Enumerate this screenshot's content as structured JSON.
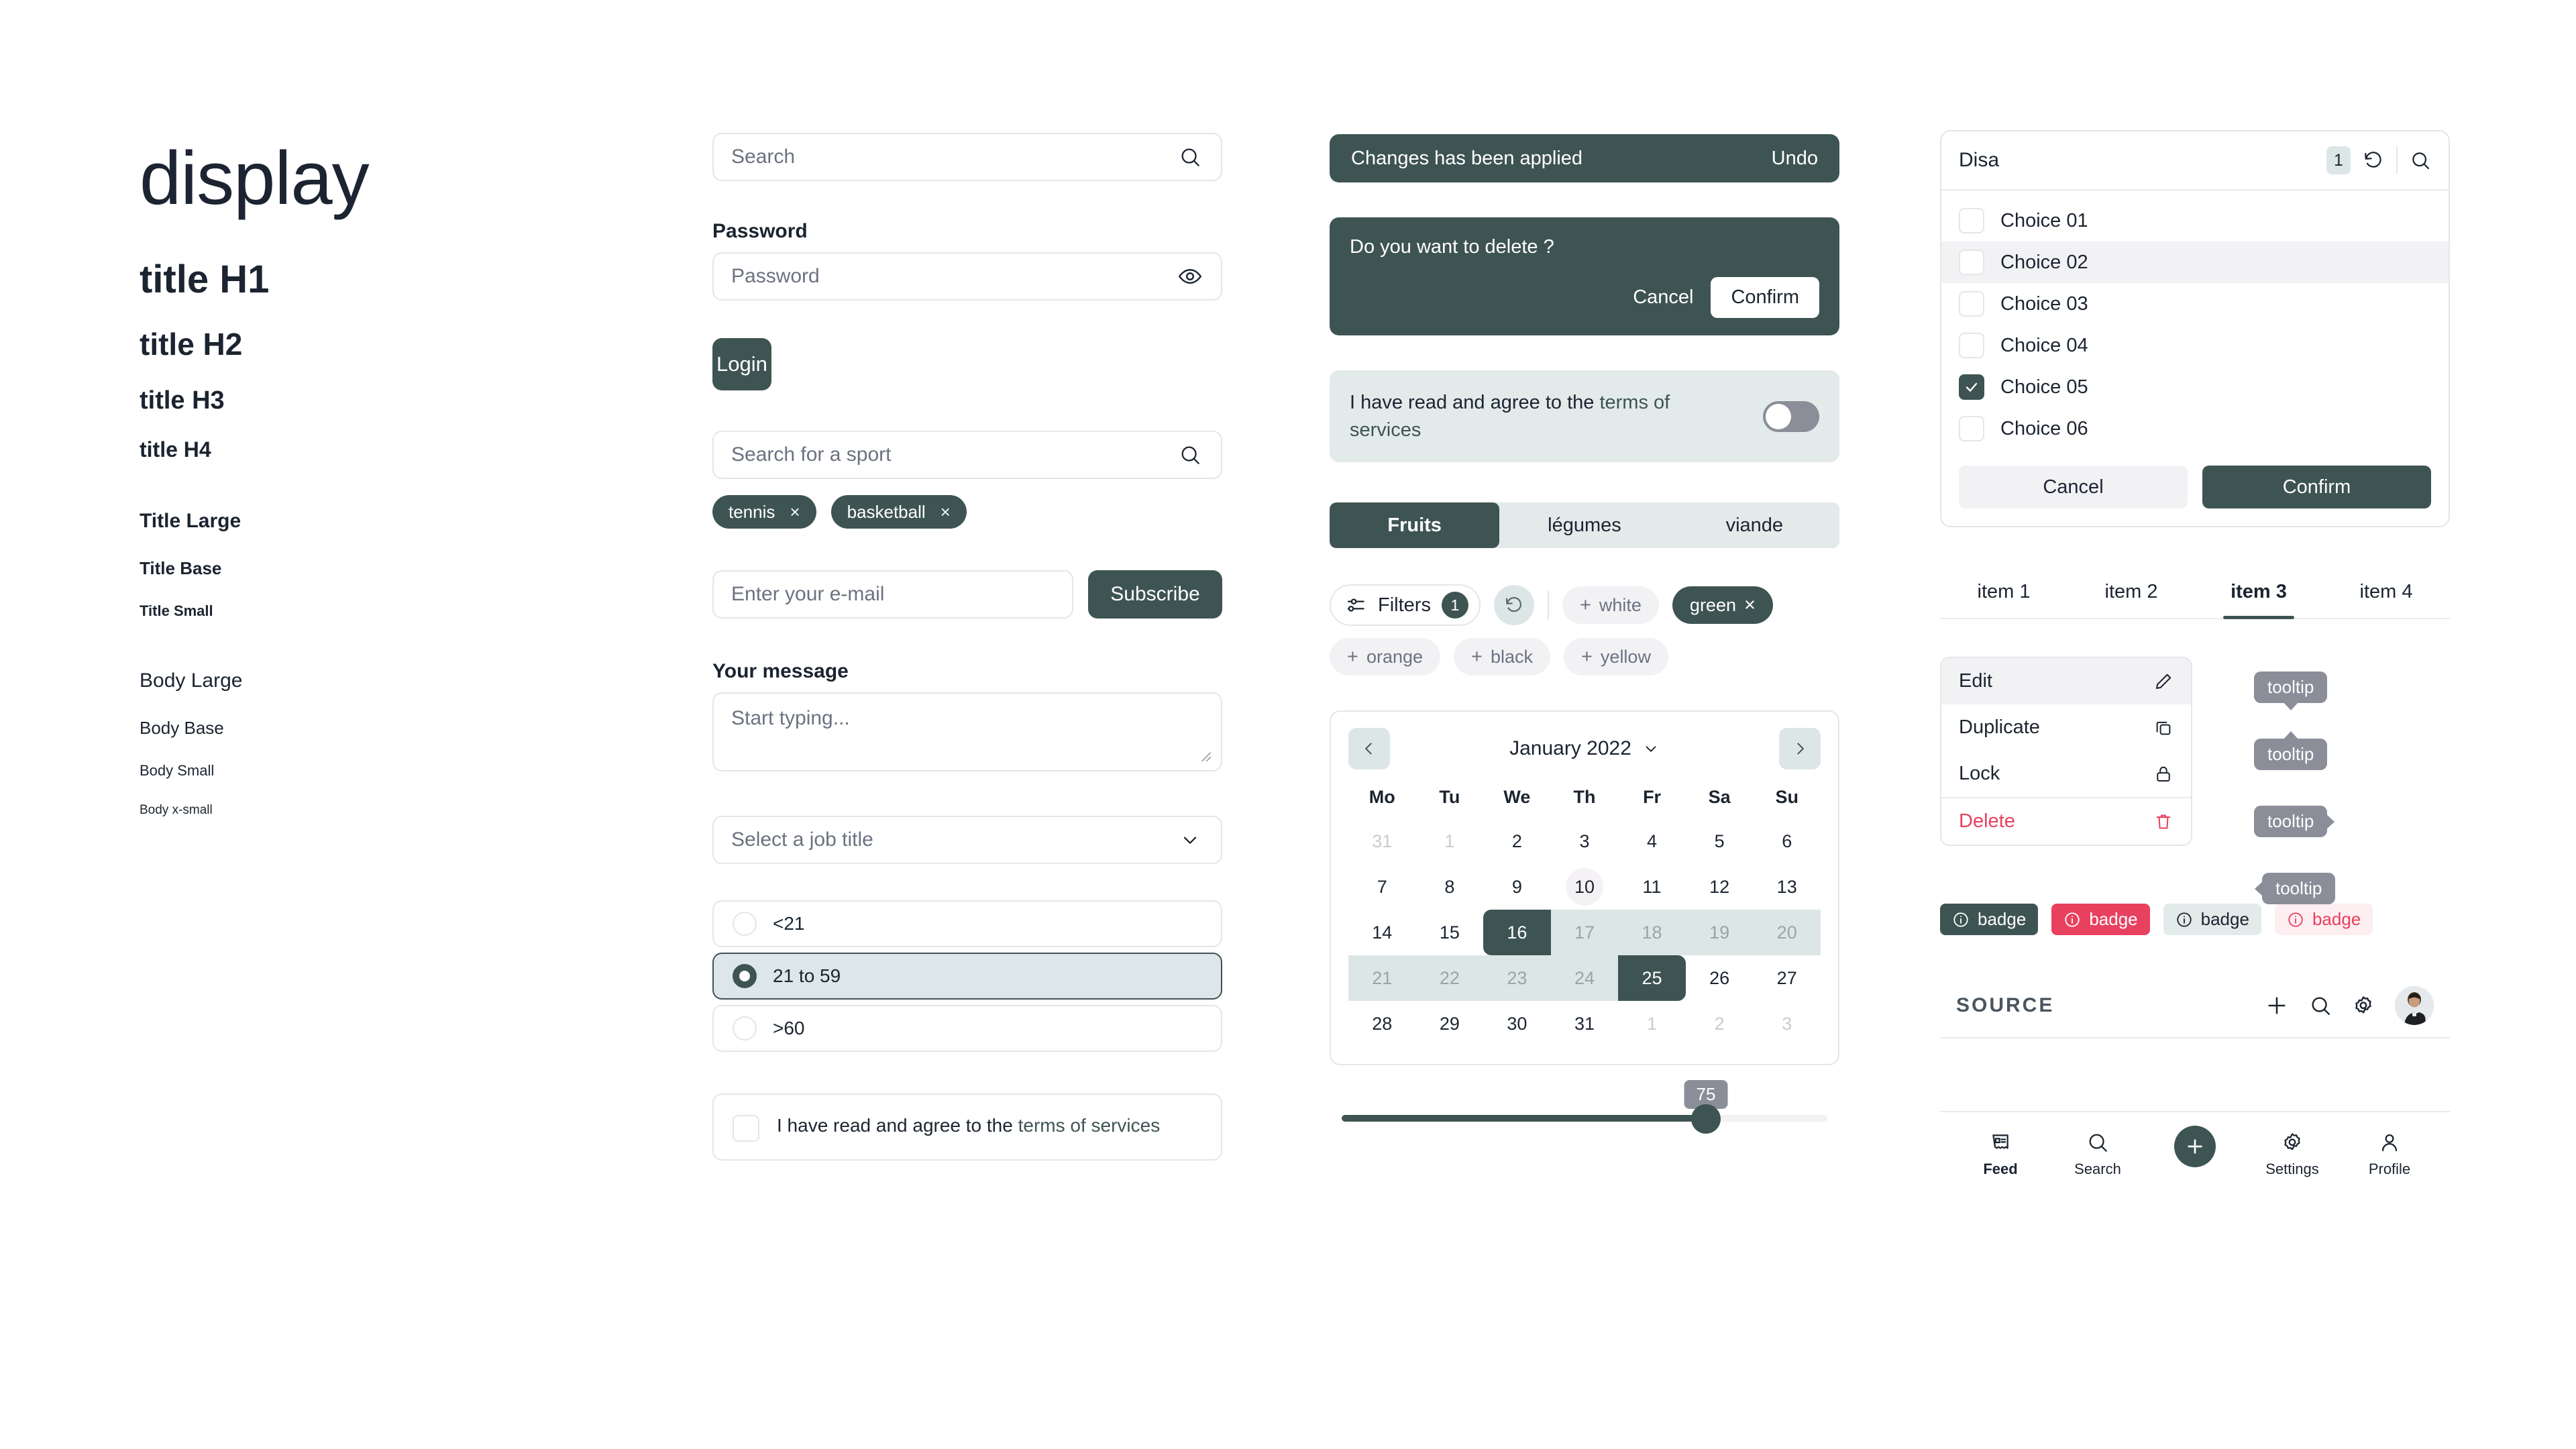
{
  "typography": {
    "display": "display",
    "h1": "title H1",
    "h2": "title H2",
    "h3": "title H3",
    "h4": "title H4",
    "title_large": "Title Large",
    "title_base": "Title Base",
    "title_small": "Title Small",
    "body_large": "Body Large",
    "body_base": "Body Base",
    "body_small": "Body Small",
    "body_xsmall": "Body x-small"
  },
  "forms": {
    "search": {
      "placeholder": "Search",
      "icon": "search-icon"
    },
    "password": {
      "label": "Password",
      "placeholder": "Password",
      "icon": "eye-icon"
    },
    "login_button": "Login",
    "sport_search": {
      "placeholder": "Search for a sport",
      "icon": "search-icon"
    },
    "tags": [
      "tennis",
      "basketball"
    ],
    "tag_remove": "×",
    "email": {
      "placeholder": "Enter your e-mail"
    },
    "subscribe_button": "Subscribe",
    "message": {
      "label": "Your message",
      "placeholder": "Start typing..."
    },
    "job_select": {
      "value": "Select a job title",
      "icon": "chevron-down-icon"
    },
    "age_options": [
      {
        "label": "<21",
        "selected": false
      },
      {
        "label": "21 to 59",
        "selected": true
      },
      {
        "label": ">60",
        "selected": false
      }
    ],
    "terms_checkbox": {
      "text": "I have read and agree to the ",
      "link": "terms of services",
      "checked": false
    }
  },
  "feedback": {
    "toast": {
      "message": "Changes has been applied",
      "action": "Undo"
    },
    "dialog": {
      "question": "Do you want to delete ?",
      "cancel": "Cancel",
      "confirm": "Confirm"
    },
    "terms_toggle": {
      "text": "I have read and agree to the ",
      "link": "terms of services",
      "on": false
    },
    "segmented": [
      {
        "label": "Fruits",
        "active": true
      },
      {
        "label": "légumes",
        "active": false
      },
      {
        "label": "viande",
        "active": false
      }
    ],
    "filters": {
      "label": "Filters",
      "count": "1",
      "reset_icon": "reset-icon"
    },
    "chips": [
      {
        "label": "white",
        "on": false,
        "prefix": "+"
      },
      {
        "label": "green",
        "on": true,
        "suffix": "×"
      },
      {
        "label": "orange",
        "on": false,
        "prefix": "+"
      },
      {
        "label": "black",
        "on": false,
        "prefix": "+"
      },
      {
        "label": "yellow",
        "on": false,
        "prefix": "+"
      }
    ]
  },
  "calendar": {
    "title": "January 2022",
    "prev_icon": "chevron-left-icon",
    "next_icon": "chevron-right-icon",
    "dropdown_icon": "chevron-down-icon",
    "dows": [
      "Mo",
      "Tu",
      "We",
      "Th",
      "Fr",
      "Sa",
      "Su"
    ],
    "weeks": [
      [
        {
          "d": "31",
          "s": "mut"
        },
        {
          "d": "1",
          "s": "mut"
        },
        {
          "d": "2",
          "s": ""
        },
        {
          "d": "3",
          "s": ""
        },
        {
          "d": "4",
          "s": ""
        },
        {
          "d": "5",
          "s": ""
        },
        {
          "d": "6",
          "s": ""
        }
      ],
      [
        {
          "d": "7",
          "s": ""
        },
        {
          "d": "8",
          "s": ""
        },
        {
          "d": "9",
          "s": ""
        },
        {
          "d": "10",
          "s": "hov"
        },
        {
          "d": "11",
          "s": ""
        },
        {
          "d": "12",
          "s": ""
        },
        {
          "d": "13",
          "s": ""
        }
      ],
      [
        {
          "d": "14",
          "s": ""
        },
        {
          "d": "15",
          "s": ""
        },
        {
          "d": "16",
          "s": "sel l"
        },
        {
          "d": "17",
          "s": "inr"
        },
        {
          "d": "18",
          "s": "inr"
        },
        {
          "d": "19",
          "s": "inr"
        },
        {
          "d": "20",
          "s": "inr"
        }
      ],
      [
        {
          "d": "21",
          "s": "inr"
        },
        {
          "d": "22",
          "s": "inr"
        },
        {
          "d": "23",
          "s": "inr"
        },
        {
          "d": "24",
          "s": "inr"
        },
        {
          "d": "25",
          "s": "sel r"
        },
        {
          "d": "26",
          "s": ""
        },
        {
          "d": "27",
          "s": ""
        }
      ],
      [
        {
          "d": "28",
          "s": ""
        },
        {
          "d": "29",
          "s": ""
        },
        {
          "d": "30",
          "s": ""
        },
        {
          "d": "31",
          "s": ""
        },
        {
          "d": "1",
          "s": "mut"
        },
        {
          "d": "2",
          "s": "mut"
        },
        {
          "d": "3",
          "s": "mut"
        }
      ]
    ]
  },
  "slider": {
    "value": "75",
    "percent": 75
  },
  "choice_panel": {
    "header_value": "Disa",
    "count": "1",
    "reset_icon": "reset-icon",
    "search_icon": "search-icon",
    "choices": [
      {
        "label": "Choice 01",
        "checked": false,
        "highlight": false
      },
      {
        "label": "Choice 02",
        "checked": false,
        "highlight": true
      },
      {
        "label": "Choice 03",
        "checked": false,
        "highlight": false
      },
      {
        "label": "Choice 04",
        "checked": false,
        "highlight": false
      },
      {
        "label": "Choice 05",
        "checked": true,
        "highlight": false
      },
      {
        "label": "Choice 06",
        "checked": false,
        "highlight": false
      }
    ],
    "cancel": "Cancel",
    "confirm": "Confirm"
  },
  "tabs": [
    {
      "label": "item 1",
      "active": false
    },
    {
      "label": "item 2",
      "active": false
    },
    {
      "label": "item 3",
      "active": true
    },
    {
      "label": "item 4",
      "active": false
    }
  ],
  "context_menu": [
    {
      "label": "Edit",
      "icon": "pencil-icon",
      "highlight": true,
      "danger": false
    },
    {
      "label": "Duplicate",
      "icon": "copy-icon",
      "highlight": false,
      "danger": false
    },
    {
      "label": "Lock",
      "icon": "lock-icon",
      "highlight": false,
      "danger": false
    },
    {
      "label": "Delete",
      "icon": "trash-icon",
      "highlight": false,
      "danger": true
    }
  ],
  "tooltips": [
    {
      "label": "tooltip",
      "arrow": "bottom"
    },
    {
      "label": "tooltip",
      "arrow": "top"
    },
    {
      "label": "tooltip",
      "arrow": "right"
    },
    {
      "label": "tooltip",
      "arrow": "left"
    }
  ],
  "badges": [
    {
      "label": "badge",
      "variant": "dark"
    },
    {
      "label": "badge",
      "variant": "red"
    },
    {
      "label": "badge",
      "variant": "light"
    },
    {
      "label": "badge",
      "variant": "redsoft"
    }
  ],
  "appbar": {
    "brand": "SOURCE",
    "icons": [
      "plus-icon",
      "search-icon",
      "gear-icon"
    ],
    "avatar": "user-avatar"
  },
  "bottom_nav": [
    {
      "label": "Feed",
      "icon": "feed-icon",
      "active": true
    },
    {
      "label": "Search",
      "icon": "search-icon",
      "active": false
    },
    {
      "label": "",
      "icon": "plus-fab-icon",
      "active": false
    },
    {
      "label": "Settings",
      "icon": "gear-icon",
      "active": false
    },
    {
      "label": "Profile",
      "icon": "profile-icon",
      "active": false
    }
  ],
  "colors": {
    "primary": "#3e5453",
    "danger": "#e8405f",
    "surface_soft": "#f2f2f5",
    "surface_teal": "#dde6e6",
    "tooltip": "#8b8e99"
  }
}
